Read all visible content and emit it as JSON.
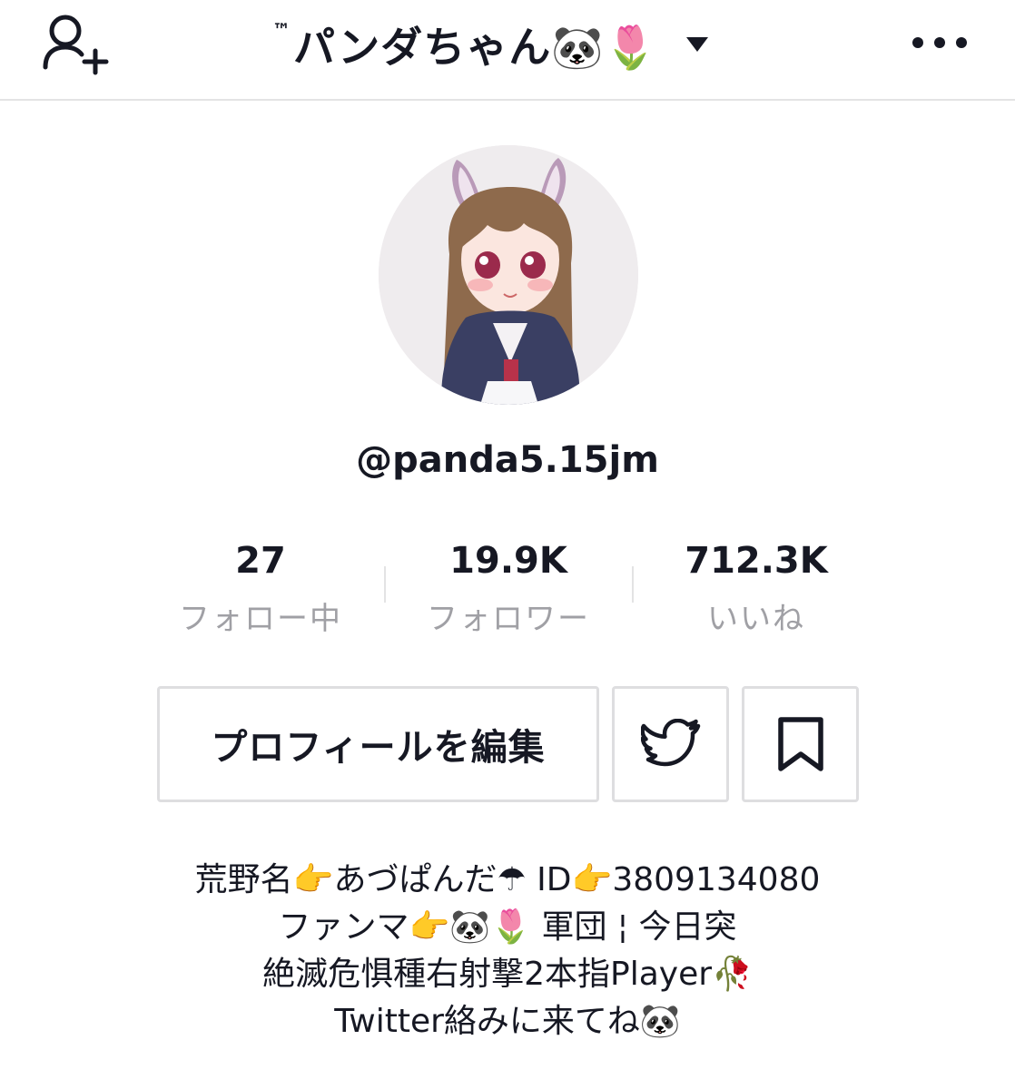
{
  "header": {
    "tm": "™",
    "title": "パンダちゃん🐼🌷",
    "add_user_icon": "add-user-icon",
    "caret_icon": "chevron-down-icon",
    "more_icon": "more-icon"
  },
  "profile": {
    "username": "@panda5.15jm"
  },
  "stats": [
    {
      "value": "27",
      "label": "フォロー中"
    },
    {
      "value": "19.9K",
      "label": "フォロワー"
    },
    {
      "value": "712.3K",
      "label": "いいね"
    }
  ],
  "actions": {
    "edit_label": "プロフィールを編集",
    "twitter_icon": "twitter-icon",
    "bookmark_icon": "bookmark-icon"
  },
  "bio": {
    "lines": [
      "荒野名👉あづぱんだ☂ ID👉3809134080",
      "ファンマ👉🐼🌷 軍団 ¦ 今日突",
      "絶滅危惧種右射撃2本指Player🥀",
      "Twitter絡みに来てね🐼"
    ]
  },
  "colors": {
    "text": "#161823",
    "muted": "#a0a0a5",
    "border": "#dedee0"
  }
}
